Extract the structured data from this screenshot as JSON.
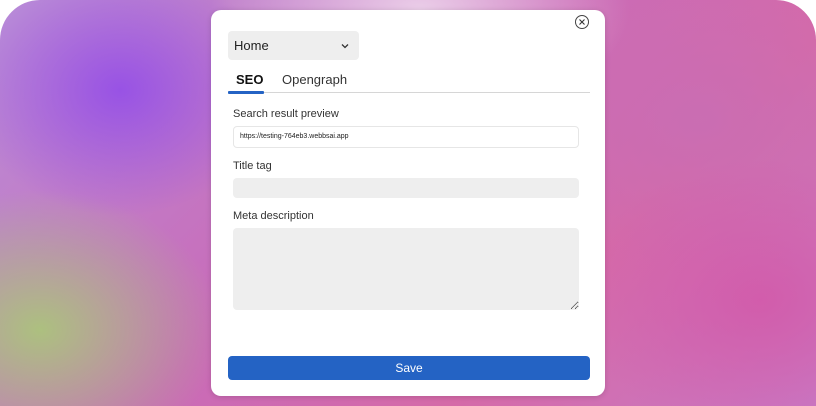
{
  "colors": {
    "accent": "#2463c4",
    "panel_bg": "#ffffff",
    "field_bg": "#eeeeee"
  },
  "page_select": {
    "value": "Home"
  },
  "tabs": [
    {
      "label": "SEO",
      "active": true
    },
    {
      "label": "Opengraph",
      "active": false
    }
  ],
  "seo": {
    "search_preview_label": "Search result preview",
    "search_preview_url": "https://testing-764eb3.webbsai.app",
    "title_tag_label": "Title tag",
    "title_tag_value": "",
    "meta_description_label": "Meta description",
    "meta_description_value": ""
  },
  "actions": {
    "save_label": "Save"
  },
  "icons": {
    "close": "close-circle-icon",
    "dropdown": "chevron-down-icon"
  }
}
